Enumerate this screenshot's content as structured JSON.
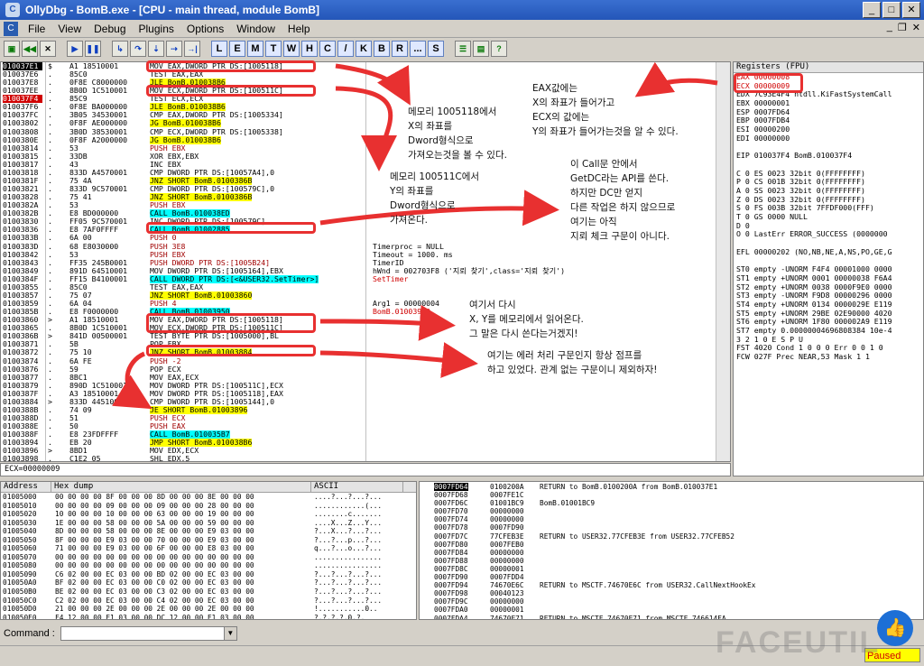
{
  "titlebar": {
    "title": "OllyDbg - BomB.exe - [CPU - main thread, module BomB]",
    "logo": "C",
    "icons": [
      "minimize-icon",
      "maximize-icon",
      "close-icon"
    ]
  },
  "menubar": {
    "items": [
      "File",
      "View",
      "Debug",
      "Plugins",
      "Options",
      "Window",
      "Help"
    ]
  },
  "toolbar": {
    "letters": [
      "L",
      "E",
      "M",
      "T",
      "W",
      "H",
      "C",
      "/",
      "K",
      "B",
      "R",
      "...",
      "S"
    ],
    "buttons": [
      "open-icon",
      "rewind-icon",
      "close-icon",
      "run-icon",
      "pause-icon",
      "step-into-icon",
      "step-over-icon",
      "trace-into-icon",
      "trace-over-icon",
      "execute-till-return-icon",
      "goto-icon"
    ]
  },
  "disasm": {
    "lines": [
      {
        "a": "010037E1",
        "m": "$",
        "h": "A1 18510001",
        "i": "MOV EAX,DWORD PTR DS:[1005118]",
        "c": "",
        "k": "sel"
      },
      {
        "a": "010037E6",
        "m": ".",
        "h": "85C0",
        "i": "TEST EAX,EAX",
        "c": "",
        "k": ""
      },
      {
        "a": "010037E8",
        "m": ".",
        "h": "0F8E C8000000",
        "i": "JLE BomB.010038B6",
        "c": "",
        "k": "jmp"
      },
      {
        "a": "010037EE",
        "m": ".",
        "h": "8B0D 1C510001",
        "i": "MOV ECX,DWORD PTR DS:[100511C]",
        "c": "",
        "k": ""
      },
      {
        "a": "010037F4",
        "m": ".",
        "h": "85C9",
        "i": "TEST ECX,ECX",
        "c": "",
        "k": "eip"
      },
      {
        "a": "010037F6",
        "m": ".",
        "h": "0F8E BA000000",
        "i": "JLE BomB.010038B6",
        "c": "",
        "k": "jmp"
      },
      {
        "a": "010037FC",
        "m": ".",
        "h": "3B05 34530001",
        "i": "CMP EAX,DWORD PTR DS:[1005334]",
        "c": "",
        "k": ""
      },
      {
        "a": "01003802",
        "m": ".",
        "h": "0F8F AE000000",
        "i": "JG BomB.010038B6",
        "c": "",
        "k": "jmp"
      },
      {
        "a": "01003808",
        "m": ".",
        "h": "3B0D 38530001",
        "i": "CMP ECX,DWORD PTR DS:[1005338]",
        "c": "",
        "k": ""
      },
      {
        "a": "0100380E",
        "m": ".",
        "h": "0F8F A2000000",
        "i": "JG BomB.010038B6",
        "c": "",
        "k": "jmp"
      },
      {
        "a": "01003814",
        "m": ".",
        "h": "53",
        "i": "PUSH EBX",
        "c": "",
        "k": "push"
      },
      {
        "a": "01003815",
        "m": ".",
        "h": "33DB",
        "i": "XOR EBX,EBX",
        "c": "",
        "k": ""
      },
      {
        "a": "01003817",
        "m": ".",
        "h": "43",
        "i": "INC EBX",
        "c": "",
        "k": ""
      },
      {
        "a": "01003818",
        "m": ".",
        "h": "833D A4570001",
        "i": "CMP DWORD PTR DS:[10057A4],0",
        "c": "",
        "k": ""
      },
      {
        "a": "0100381F",
        "m": ".",
        "h": "75 4A",
        "i": "JNZ SHORT BomB.0100386B",
        "c": "",
        "k": "jmp"
      },
      {
        "a": "01003821",
        "m": ".",
        "h": "833D 9C570001",
        "i": "CMP DWORD PTR DS:[100579C],0",
        "c": "",
        "k": ""
      },
      {
        "a": "01003828",
        "m": ".",
        "h": "75 41",
        "i": "JNZ SHORT BomB.0100386B",
        "c": "",
        "k": "jmp"
      },
      {
        "a": "0100382A",
        "m": ".",
        "h": "53",
        "i": "PUSH EBX",
        "c": "",
        "k": "push"
      },
      {
        "a": "0100382B",
        "m": ".",
        "h": "E8 BD000000",
        "i": "CALL BomB.010038ED",
        "c": "",
        "k": "call"
      },
      {
        "a": "01003830",
        "m": ".",
        "h": "FF05 9C570001",
        "i": "INC DWORD PTR DS:[100579C]",
        "c": "",
        "k": ""
      },
      {
        "a": "01003836",
        "m": ".",
        "h": "E8 7AF0FFFF",
        "i": "CALL BomB.01002885",
        "c": "",
        "k": "call"
      },
      {
        "a": "0100383B",
        "m": ".",
        "h": "6A 00",
        "i": "PUSH 0",
        "c": "",
        "k": "push"
      },
      {
        "a": "0100383D",
        "m": ".",
        "h": "68 E8030000",
        "i": "PUSH 3E8",
        "c": "Timerproc = NULL",
        "k": "push"
      },
      {
        "a": "01003842",
        "m": ".",
        "h": "53",
        "i": "PUSH EBX",
        "c": "Timeout = 1000. ms",
        "k": "push"
      },
      {
        "a": "01003843",
        "m": ".",
        "h": "FF35 245B0001",
        "i": "PUSH DWORD PTR DS:[1005B24]",
        "c": "TimerID",
        "k": "push"
      },
      {
        "a": "01003849",
        "m": ".",
        "h": "891D 64510001",
        "i": "MOV DWORD PTR DS:[1005164],EBX",
        "c": "hWnd = 002703F8 ('지뢰 찾기',class='지뢰 찾기')",
        "k": ""
      },
      {
        "a": "0100384F",
        "m": ".",
        "h": "FF15 B4100001",
        "i": "CALL DWORD PTR DS:[<&USER32.SetTimer>]",
        "c": "SetTimer",
        "k": "call"
      },
      {
        "a": "01003855",
        "m": ".",
        "h": "85C0",
        "i": "TEST EAX,EAX",
        "c": "",
        "k": ""
      },
      {
        "a": "01003857",
        "m": ".",
        "h": "75 07",
        "i": "JNZ SHORT BomB.01003860",
        "c": "",
        "k": "jmp"
      },
      {
        "a": "01003859",
        "m": ".",
        "h": "6A 04",
        "i": "PUSH 4",
        "c": "Arg1 = 00000004",
        "k": "push"
      },
      {
        "a": "0100385B",
        "m": ".",
        "h": "E8 F0000000",
        "i": "CALL BomB.01003950",
        "c": "BomB.01003950",
        "k": "call"
      },
      {
        "a": "01003860",
        "m": ">",
        "h": "A1 18510001",
        "i": "MOV EAX,DWORD PTR DS:[1005118]",
        "c": "",
        "k": ""
      },
      {
        "a": "01003865",
        "m": ".",
        "h": "8B0D 1C510001",
        "i": "MOV ECX,DWORD PTR DS:[100511C]",
        "c": "",
        "k": ""
      },
      {
        "a": "0100386B",
        "m": ">",
        "h": "841D 00500001",
        "i": "TEST BYTE PTR DS:[1005000],BL",
        "c": "",
        "k": ""
      },
      {
        "a": "01003871",
        "m": ".",
        "h": "5B",
        "i": "POP EBX",
        "c": "",
        "k": ""
      },
      {
        "a": "01003872",
        "m": ".",
        "h": "75 10",
        "i": "JNZ SHORT BomB.01003884",
        "c": "",
        "k": "jmp"
      },
      {
        "a": "01003874",
        "m": ".",
        "h": "6A FE",
        "i": "PUSH -2",
        "c": "",
        "k": "push"
      },
      {
        "a": "01003876",
        "m": ".",
        "h": "59",
        "i": "POP ECX",
        "c": "",
        "k": ""
      },
      {
        "a": "01003877",
        "m": ".",
        "h": "8BC1",
        "i": "MOV EAX,ECX",
        "c": "",
        "k": ""
      },
      {
        "a": "01003879",
        "m": ".",
        "h": "890D 1C510001",
        "i": "MOV DWORD PTR DS:[100511C],ECX",
        "c": "",
        "k": ""
      },
      {
        "a": "0100387F",
        "m": ".",
        "h": "A3 18510001",
        "i": "MOV DWORD PTR DS:[1005118],EAX",
        "c": "",
        "k": ""
      },
      {
        "a": "01003884",
        "m": ">",
        "h": "833D 44510001",
        "i": "CMP DWORD PTR DS:[1005144],0",
        "c": "",
        "k": ""
      },
      {
        "a": "0100388B",
        "m": ".",
        "h": "74 09",
        "i": "JE SHORT BomB.01003896",
        "c": "",
        "k": "jmp"
      },
      {
        "a": "0100388D",
        "m": ".",
        "h": "51",
        "i": "PUSH ECX",
        "c": "",
        "k": "push"
      },
      {
        "a": "0100388E",
        "m": ".",
        "h": "50",
        "i": "PUSH EAX",
        "c": "",
        "k": "push"
      },
      {
        "a": "0100388F",
        "m": ".",
        "h": "E8 23FDFFFF",
        "i": "CALL BomB.010035B7",
        "c": "",
        "k": "call"
      },
      {
        "a": "01003894",
        "m": ".",
        "h": "EB 20",
        "i": "JMP SHORT BomB.010038B6",
        "c": "",
        "k": "jmp"
      },
      {
        "a": "01003896",
        "m": ">",
        "h": "8BD1",
        "i": "MOV EDX,ECX",
        "c": "",
        "k": ""
      },
      {
        "a": "01003898",
        "m": ".",
        "h": "C1E2 05",
        "i": "SHL EDX,5",
        "c": "",
        "k": ""
      }
    ]
  },
  "infobar": {
    "text": "ECX=00000009"
  },
  "registers": {
    "header": "Registers (FPU)",
    "lines": [
      {
        "t": "EAX 00000008",
        "red": true
      },
      {
        "t": "ECX 00000009",
        "red": true
      },
      {
        "t": "EDX 7C93E4F4 ntdll.KiFastSystemCall",
        "red": false
      },
      {
        "t": "EBX 00000001",
        "red": false
      },
      {
        "t": "ESP 0007FD64",
        "red": false
      },
      {
        "t": "EBP 0007FDB4",
        "red": false
      },
      {
        "t": "ESI 00000200",
        "red": false
      },
      {
        "t": "EDI 00000000",
        "red": false
      },
      {
        "t": "",
        "red": false
      },
      {
        "t": "EIP 010037F4 BomB.010037F4",
        "red": false
      },
      {
        "t": "",
        "red": false
      },
      {
        "t": "C 0  ES 0023 32bit 0(FFFFFFFF)",
        "red": false
      },
      {
        "t": "P 0  CS 001B 32bit 0(FFFFFFFF)",
        "red": false
      },
      {
        "t": "A 0  SS 0023 32bit 0(FFFFFFFF)",
        "red": false
      },
      {
        "t": "Z 0  DS 0023 32bit 0(FFFFFFFF)",
        "red": false
      },
      {
        "t": "S 0  FS 003B 32bit 7FFDF000(FFF)",
        "red": false
      },
      {
        "t": "T 0  GS 0000 NULL",
        "red": false
      },
      {
        "t": "D 0",
        "red": false
      },
      {
        "t": "O 0  LastErr ERROR_SUCCESS (0000000",
        "red": false
      },
      {
        "t": "",
        "red": false
      },
      {
        "t": "EFL 00000202 (NO,NB,NE,A,NS,PO,GE,G",
        "red": false
      },
      {
        "t": "",
        "red": false
      },
      {
        "t": "ST0 empty -UNORM F4F4 00001000 0000",
        "red": false
      },
      {
        "t": "ST1 empty +UNORM 0001 00000038 F6A4",
        "red": false
      },
      {
        "t": "ST2 empty +UNORM 0038 0000F9E0 0000",
        "red": false
      },
      {
        "t": "ST3 empty -UNORM F9D8 00000296 0000",
        "red": false
      },
      {
        "t": "ST4 empty +UNORM 0134 0000029E E119",
        "red": false
      },
      {
        "t": "ST5 empty +UNORM 29BE 02E90000 4020",
        "red": false
      },
      {
        "t": "ST6 empty +UNORM 1F80 000002A9 E119",
        "red": false
      },
      {
        "t": "ST7 empty 0.00000004696808384 10e-4",
        "red": false
      },
      {
        "t": "              3 2 1 0      E S P U",
        "red": false
      },
      {
        "t": "FST 4020  Cond 1 0 0 0  Err 0 0 1 0",
        "red": false
      },
      {
        "t": "FCW 027F  Prec NEAR,53  Mask    1 1",
        "red": false
      }
    ]
  },
  "dump": {
    "headers": [
      "Address",
      "Hex dump",
      "ASCII"
    ],
    "rows": [
      {
        "a": "01005000",
        "h": "00 00 00 00 8F 00 00 00 8D 00 00 00 8E 00 00 00",
        "s": "....?...?...?..."
      },
      {
        "a": "01005010",
        "h": "00 00 00 00 09 00 00 00 09 00 00 00 28 00 00 00",
        "s": "............(..."
      },
      {
        "a": "01005020",
        "h": "10 00 00 00 10 00 00 00 63 00 00 00 19 00 00 00",
        "s": "........c......."
      },
      {
        "a": "01005030",
        "h": "1E 00 00 00 58 00 00 00 5A 00 00 00 59 00 00 00",
        "s": "....X...Z...Y..."
      },
      {
        "a": "01005040",
        "h": "8D 00 00 00 58 00 00 00 8E 00 00 00 E9 03 00 00",
        "s": "?...X...?...?..."
      },
      {
        "a": "01005050",
        "h": "8F 00 00 00 E9 03 00 00 70 00 00 00 E9 03 00 00",
        "s": "?...?...p...?..."
      },
      {
        "a": "01005060",
        "h": "71 00 00 00 E9 03 00 00 6F 00 00 00 E8 03 00 00",
        "s": "q...?...o...?..."
      },
      {
        "a": "01005070",
        "h": "00 00 00 00 00 00 00 00 00 00 00 00 00 00 00 00",
        "s": "................"
      },
      {
        "a": "01005080",
        "h": "00 00 00 00 00 00 00 00 00 00 00 00 00 00 00 00",
        "s": "................"
      },
      {
        "a": "01005090",
        "h": "C6 02 00 00 EC 03 00 00 BD 02 00 00 EC 03 00 00",
        "s": "?...?...?...?..."
      },
      {
        "a": "010050A0",
        "h": "BF 02 00 00 EC 03 00 00 C0 02 00 00 EC 03 00 00",
        "s": "?...?...?...?..."
      },
      {
        "a": "010050B0",
        "h": "BE 02 00 00 EC 03 00 00 C3 02 00 00 EC 03 00 00",
        "s": "?...?...?...?..."
      },
      {
        "a": "010050C0",
        "h": "C2 02 00 00 EC 03 00 00 C4 02 00 00 EC 03 00 00",
        "s": "?...?...?...?..."
      },
      {
        "a": "010050D0",
        "h": "21 00 00 00 2E 00 00 00 2E 00 00 00 2E 00 00 00",
        "s": "!...........0.."
      },
      {
        "a": "010050E0",
        "h": "F4 12 00 00 E1 03 00 00 DC 12 00 00 E1 03 00 00",
        "s": "?.?.?.?.0.?."
      },
      {
        "a": "010050F0",
        "h": "F4 12 00 00 E8 12 00 00 DC 12 00 00 E2 03 00 00",
        "s": "?.?.?.?.?.0."
      }
    ]
  },
  "stack": {
    "rows": [
      {
        "a": "0007FD64",
        "v": "0100200A",
        "c": "RETURN to BomB.0100200A from BomB.010037E1",
        "top": true
      },
      {
        "a": "0007FD68",
        "v": "0007FE1C",
        "c": "",
        "top": false
      },
      {
        "a": "0007FD6C",
        "v": "01001BC9",
        "c": "BomB.01001BC9",
        "top": false
      },
      {
        "a": "0007FD70",
        "v": "00000000",
        "c": "",
        "top": false
      },
      {
        "a": "0007FD74",
        "v": "00000000",
        "c": "",
        "top": false
      },
      {
        "a": "0007FD78",
        "v": "0007FD90",
        "c": "",
        "top": false
      },
      {
        "a": "0007FD7C",
        "v": "77CFEB3E",
        "c": "RETURN to USER32.77CFEB3E from USER32.77CFEB52",
        "top": false
      },
      {
        "a": "0007FD80",
        "v": "0007FEB0",
        "c": "",
        "top": false
      },
      {
        "a": "0007FD84",
        "v": "00000000",
        "c": "",
        "top": false
      },
      {
        "a": "0007FD88",
        "v": "00000000",
        "c": "",
        "top": false
      },
      {
        "a": "0007FD8C",
        "v": "00000001",
        "c": "",
        "top": false
      },
      {
        "a": "0007FD90",
        "v": "0007FDD4",
        "c": "",
        "top": false
      },
      {
        "a": "0007FD94",
        "v": "74670E6C",
        "c": "RETURN to MSCTF.74670E6C from USER32.CallNextHookEx",
        "top": false
      },
      {
        "a": "0007FD98",
        "v": "00040123",
        "c": "",
        "top": false
      },
      {
        "a": "0007FD9C",
        "v": "00000000",
        "c": "",
        "top": false
      },
      {
        "a": "0007FDA0",
        "v": "00000001",
        "c": "",
        "top": false
      },
      {
        "a": "0007FDA4",
        "v": "74670E71",
        "c": "RETURN to MSCTF.74670E71 from MSCTF.746614FA",
        "top": false
      }
    ]
  },
  "command": {
    "label": "Command :",
    "value": ""
  },
  "status": {
    "state": "Paused"
  },
  "watermark": {
    "text": "FACEUTIL"
  },
  "annotations": {
    "note1": "메모리 1005118에서\nX의 좌표를\nDword형식으로\n가져오는것을 볼 수 있다.",
    "note2": "EAX값에는\nX의 좌표가 들어가고\nECX의 값에는\nY의 좌표가 들어가는것을 알 수 있다.",
    "note3": "메모리 100511C에서\nY의 좌표를\nDword형식으로\n가져온다.",
    "note4": "이 Call문 안에서\nGetDC라는 API를 쓴다.\n하지만 DC만 얻지\n다른 작업은 하지 않으므로\n여기는 아직\n지뢰 체크 구문이 아니다.",
    "note5": "여기서 다시\nX, Y를 메모리에서 읽어온다.\n그 말은 다시 쓴다는거겠지!",
    "note6": "여기는 에러 처리 구문인지 항상 점프를\n하고 있었다. 관계 없는 구문이니 제외하자!"
  },
  "colors": {
    "accent": "#e83030",
    "titlebar": "#2456b8",
    "jump": "#ffff00",
    "call": "#00ffff",
    "eip": "#d00000"
  }
}
